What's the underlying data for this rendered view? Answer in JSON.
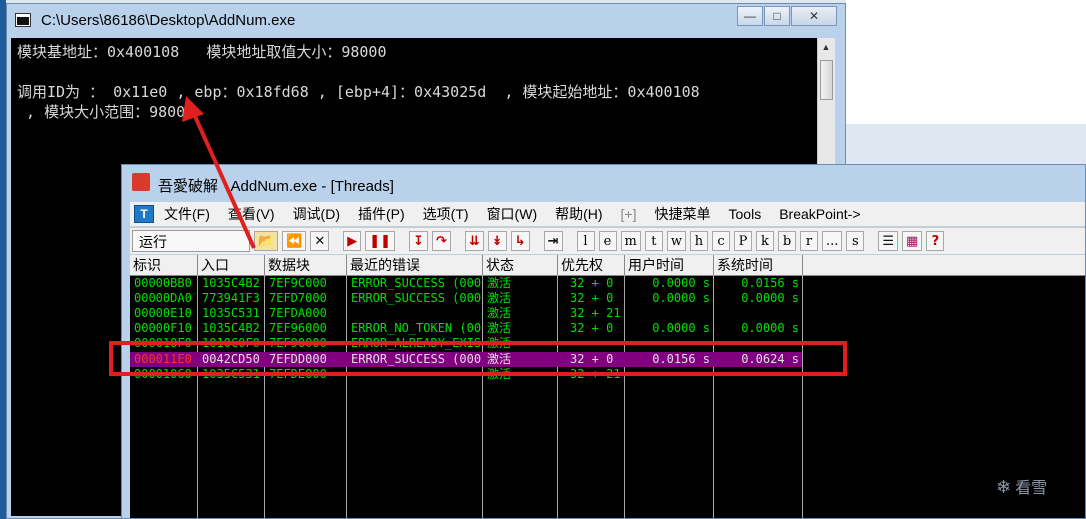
{
  "console": {
    "title": "C:\\Users\\86186\\Desktop\\AddNum.exe",
    "lines": [
      "模块基地址：0x400108   模块地址取值大小：98000",
      "",
      "调用ID为 ： 0x11e0 , ebp：0x18fd68 , [ebp+4]：0x43025d  , 模块起始地址：0x400108",
      " , 模块大小范围：98000"
    ]
  },
  "olly": {
    "app_name": "吾愛破解",
    "title": "AddNum.exe - [Threads]",
    "menu": [
      "文件(F)",
      "查看(V)",
      "调试(D)",
      "插件(P)",
      "选项(T)",
      "窗口(W)",
      "帮助(H)",
      "[+]",
      "快捷菜单",
      "Tools",
      "BreakPoint->"
    ],
    "status": "运行",
    "toolbar_letters": [
      "l",
      "e",
      "m",
      "t",
      "w",
      "h",
      "c",
      "P",
      "k",
      "b",
      "r",
      "...",
      "s"
    ],
    "columns": [
      "标识",
      "入口",
      "数据块",
      "最近的错误",
      "状态",
      "优先权",
      "用户时间",
      "系统时间"
    ],
    "rows": [
      {
        "id": "00000BB0",
        "entry": "1035C4B2",
        "block": "7EF9C000",
        "error": "ERROR_SUCCESS (000",
        "state": "激活",
        "prio": "32 + 0",
        "user": "0.0000 s",
        "sys": "0.0156 s"
      },
      {
        "id": "00000DA0",
        "entry": "773941F3",
        "block": "7EFD7000",
        "error": "ERROR_SUCCESS (000",
        "state": "激活",
        "prio": "32 + 0",
        "user": "0.0000 s",
        "sys": "0.0000 s"
      },
      {
        "id": "00000E10",
        "entry": "1035C531",
        "block": "7EFDA000",
        "error": "",
        "state": "激活",
        "prio": "32 + 21",
        "user": "",
        "sys": ""
      },
      {
        "id": "00000F10",
        "entry": "1035C4B2",
        "block": "7EF96000",
        "error": "ERROR_NO_TOKEN (00",
        "state": "激活",
        "prio": "32 + 0",
        "user": "0.0000 s",
        "sys": "0.0000 s"
      },
      {
        "id": "000010F0",
        "entry": "1010C0F0",
        "block": "7EF90000",
        "error": "ERROR_ALREADY_EXIS",
        "state": "激活",
        "prio": "",
        "user": "",
        "sys": ""
      },
      {
        "id": "000011E0",
        "entry": "0042CD50",
        "block": "7EFDD000",
        "error": "ERROR_SUCCESS (000",
        "state": "激活",
        "prio": "32 + 0",
        "user": "0.0156 s",
        "sys": "0.0624 s",
        "selected": true
      },
      {
        "id": "00001060",
        "entry": "1035C531",
        "block": "7EFDE000",
        "error": "",
        "state": "激活",
        "prio": "32 + 21",
        "user": "",
        "sys": ""
      }
    ]
  },
  "watermark": "看雪",
  "colors": {
    "grid_text": "#00e000",
    "selected_row": "#800080",
    "highlight": "#e0201e"
  }
}
